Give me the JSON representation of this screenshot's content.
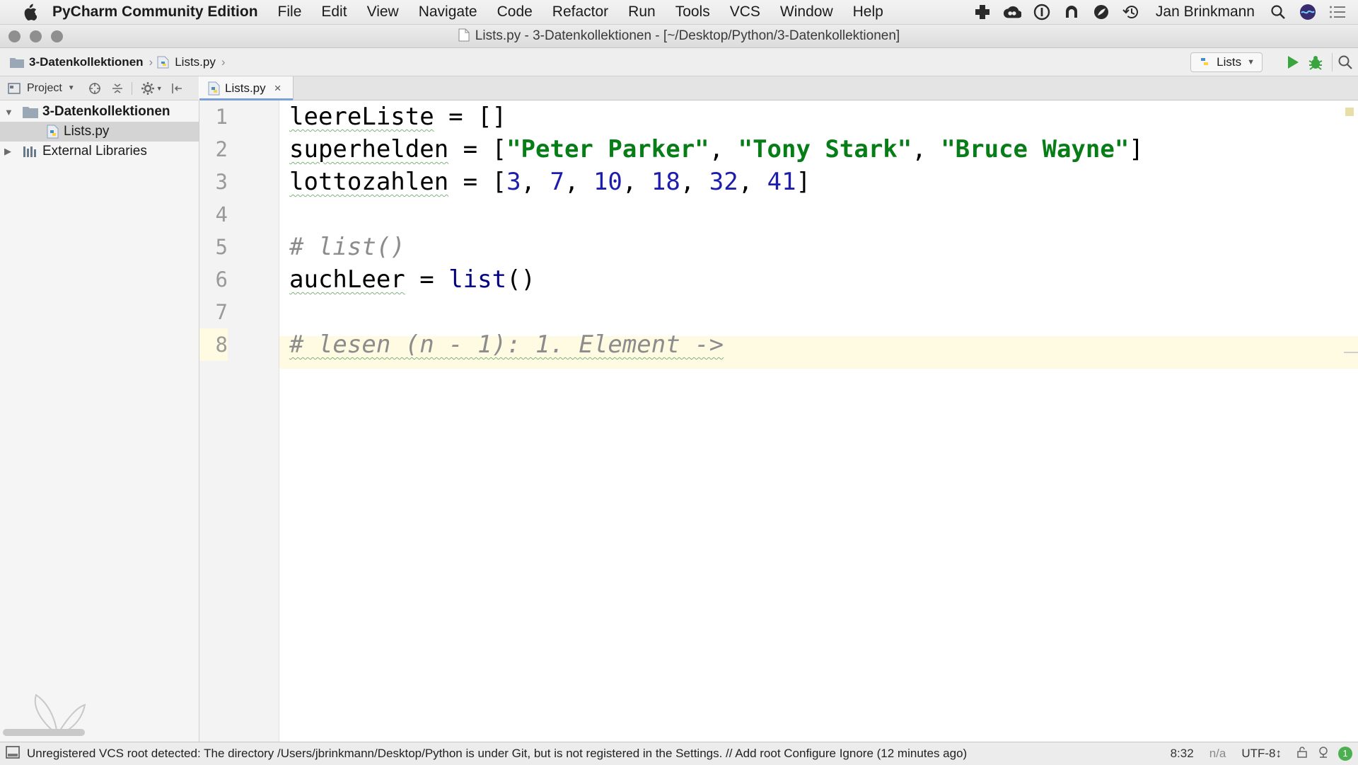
{
  "menubar": {
    "app_name": "PyCharm Community Edition",
    "items": [
      "File",
      "Edit",
      "View",
      "Navigate",
      "Code",
      "Refactor",
      "Run",
      "Tools",
      "VCS",
      "Window",
      "Help"
    ],
    "tray_icons": [
      "plus-tray-icon",
      "creative-cloud-icon",
      "password-manager-icon",
      "sound-icon",
      "leaf-icon",
      "time-machine-icon"
    ],
    "user_name": "Jan Brinkmann"
  },
  "window": {
    "title": "Lists.py - 3-Datenkollektionen - [~/Desktop/Python/3-Datenkollektionen]"
  },
  "navbar": {
    "breadcrumbs": [
      "3-Datenkollektionen",
      "Lists.py"
    ],
    "run_config": "Lists"
  },
  "project_panel": {
    "view_label": "Project",
    "tree": [
      {
        "label": "3-Datenkollektionen",
        "expanded": true,
        "bold": true
      },
      {
        "label": "Lists.py",
        "selected": true
      },
      {
        "label": "External Libraries",
        "expanded": false
      }
    ]
  },
  "editor": {
    "tab_label": "Lists.py",
    "line_numbers": [
      "1",
      "2",
      "3",
      "4",
      "5",
      "6",
      "7",
      "8"
    ],
    "lines": {
      "l1": {
        "ident": "leereListe",
        "rest": " = []"
      },
      "l2": {
        "ident": "superhelden",
        "op": " = [",
        "s1": "\"Peter Parker\"",
        "c1": ", ",
        "s2": "\"Tony Stark\"",
        "c2": ", ",
        "s3": "\"Bruce Wayne\"",
        "end": "]"
      },
      "l3": {
        "ident": "lottozahlen",
        "op": " = [",
        "nums": [
          "3",
          "7",
          "10",
          "18",
          "32",
          "41"
        ],
        "sep": ", ",
        "end": "]"
      },
      "l5": {
        "comment": "# list()"
      },
      "l6": {
        "ident": "auchLeer",
        "op": " = ",
        "fn": "list",
        "end": "()"
      },
      "l8": {
        "comment": "# lesen (n - 1): 1. Element ->"
      }
    },
    "current_line": 8
  },
  "statusbar": {
    "message": "Unregistered VCS root detected: The directory /Users/jbrinkmann/Desktop/Python is under Git, but is not registered in the Settings. // Add root  Configure  Ignore (12 minutes ago)",
    "position": "8:32",
    "na": "n/a",
    "encoding": "UTF-8↕",
    "event_count": "1"
  },
  "colors": {
    "string": "#067d17",
    "number": "#1d1dad",
    "comment": "#8c8c8c",
    "caret_row": "#fffbe3"
  }
}
